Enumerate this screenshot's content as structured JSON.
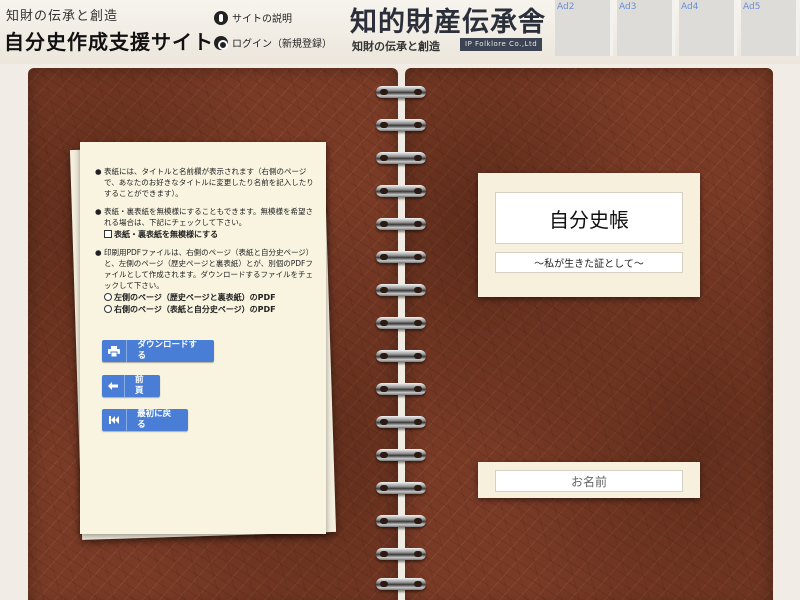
{
  "header": {
    "site_subtitle": "知財の伝承と創造",
    "site_title": "自分史作成支援サイト",
    "about_link": "サイトの説明",
    "login_link": "ログイン（新規登録）",
    "brand_name": "知的財産伝承舎",
    "brand_tagline": "知財の伝承と創造",
    "brand_badge": "IP Folklore Co.,Ltd",
    "ads": [
      "Ad2",
      "Ad3",
      "Ad4",
      "Ad5"
    ]
  },
  "instructions": {
    "item1": "表紙には、タイトルと名前欄が表示されます（右側のページで、あなたのお好きなタイトルに変更したり名前を記入したりすることができます）。",
    "item2": "表紙・裏表紙を無模様にすることもできます。無模様を希望される場合は、下記にチェックして下さい。",
    "plain_cover_checkbox": "表紙・裏表紙を無模様にする",
    "item3": "印刷用PDFファイルは、右側のページ（表紙と自分史ページ）と、左側のページ（歴史ページと裏表紙）とが、別個のPDFファイルとして作成されます。ダウンロードするファイルをチェックして下さい。",
    "radio_left": "左側のページ（歴史ページと裏表紙）のPDF",
    "radio_right": "右側のページ（表紙と自分史ページ）のPDF",
    "bullet": "●"
  },
  "buttons": {
    "download": "ダウンロードする",
    "prev": "前頁",
    "first": "最初に戻る"
  },
  "cover": {
    "title": "自分史帳",
    "subtitle": "～私が生きた証として～",
    "name_placeholder": "お名前"
  },
  "colors": {
    "cover_brown": "#7a3b26",
    "button_blue": "#4a7ed6",
    "paper": "#f9f4e0"
  },
  "icons": {
    "about": "info-icon",
    "login": "key-icon",
    "download": "printer-icon",
    "prev": "arrow-left-icon",
    "first": "skip-to-start-icon"
  }
}
